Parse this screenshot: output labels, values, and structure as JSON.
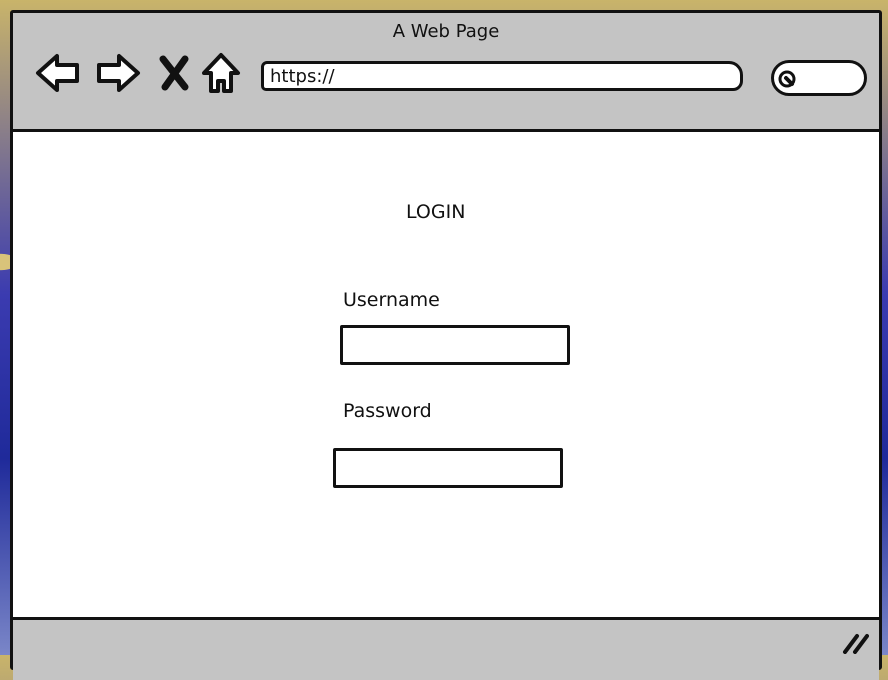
{
  "window": {
    "title": "A Web Page"
  },
  "toolbar": {
    "icons": [
      "back-arrow-icon",
      "forward-arrow-icon",
      "close-x-icon",
      "home-icon",
      "search-icon",
      "resize-grip-icon"
    ],
    "url": "https://"
  },
  "login": {
    "title": "LOGIN",
    "username_label": "Username",
    "username_value": "",
    "password_label": "Password",
    "password_value": ""
  },
  "colors": {
    "chrome": "#c4c4c4",
    "stroke": "#111111",
    "page": "#ffffff"
  }
}
